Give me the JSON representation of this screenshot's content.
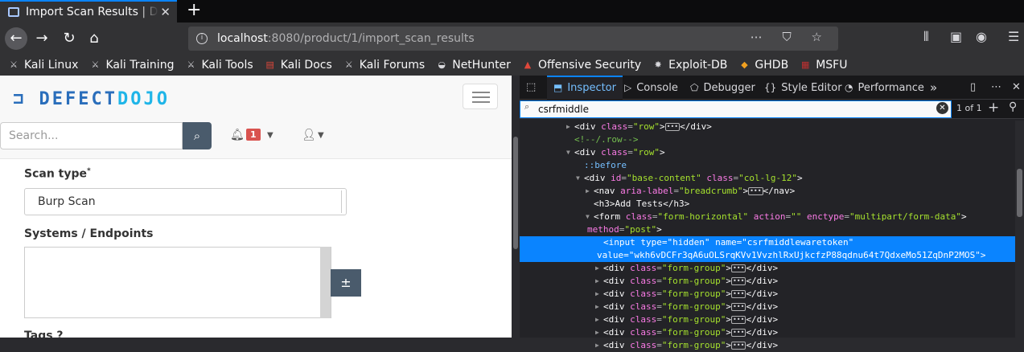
{
  "browser": {
    "tab_title": "Import Scan Results | DefectDojo",
    "tab_close": "✕",
    "new_tab": "+",
    "url_host": "localhost",
    "url_rest": ":8080/product/1/import_scan_results",
    "url_actions": "⋯ ⛉ ☆",
    "bookmarks": [
      {
        "label": "Kali Linux",
        "icon": "kali-dragon-icon"
      },
      {
        "label": "Kali Training",
        "icon": "kali-dragon-icon"
      },
      {
        "label": "Kali Tools",
        "icon": "kali-dragon-icon"
      },
      {
        "label": "Kali Docs",
        "icon": "kali-docs-icon"
      },
      {
        "label": "Kali Forums",
        "icon": "kali-dragon-icon"
      },
      {
        "label": "NetHunter",
        "icon": "nethunter-icon"
      },
      {
        "label": "Offensive Security",
        "icon": "offsec-icon"
      },
      {
        "label": "Exploit-DB",
        "icon": "exploitdb-icon"
      },
      {
        "label": "GHDB",
        "icon": "ghdb-icon"
      },
      {
        "label": "MSFU",
        "icon": "msfu-icon"
      }
    ]
  },
  "page": {
    "logo_left": "DEFECT",
    "logo_right": "DOJO",
    "search_placeholder": "Search...",
    "notification_count": "1",
    "scan_type_label": "Scan type",
    "scan_type_required": "*",
    "scan_type_value": "Burp Scan",
    "systems_label": "Systems / Endpoints",
    "plus_button": "±",
    "tags_label": "Tags"
  },
  "devtools": {
    "tabs": [
      "Inspector",
      "Console",
      "Debugger",
      "Style Editor",
      "Performance"
    ],
    "search_value": "csrfmiddle",
    "match_count": "1 of 1",
    "tree": [
      {
        "kind": "collapsed",
        "indent": 0,
        "tag": "div",
        "attrs": [
          [
            "class",
            "row"
          ]
        ]
      },
      {
        "kind": "comment",
        "indent": 0,
        "text": "<!--/.row-->"
      },
      {
        "kind": "open",
        "indent": 0,
        "tag": "div",
        "attrs": [
          [
            "class",
            "row"
          ]
        ]
      },
      {
        "kind": "pseudo",
        "indent": 1,
        "text": "::before"
      },
      {
        "kind": "open",
        "indent": 1,
        "tag": "div",
        "attrs": [
          [
            "id",
            "base-content"
          ],
          [
            "class",
            "col-lg-12"
          ]
        ]
      },
      {
        "kind": "collapsed",
        "indent": 2,
        "tag": "nav",
        "attrs": [
          [
            "aria-label",
            "breadcrumb"
          ]
        ]
      },
      {
        "kind": "text",
        "indent": 2,
        "text": "<h3>Add Tests</h3>"
      },
      {
        "kind": "open",
        "indent": 2,
        "tag": "form",
        "attrs": [
          [
            "class",
            "form-horizontal"
          ],
          [
            "action",
            ""
          ],
          [
            "enctype",
            "multipart/form-data"
          ]
        ]
      },
      {
        "kind": "cont",
        "indent": 2,
        "attrs": [
          [
            "method",
            "post"
          ]
        ]
      },
      {
        "kind": "selected",
        "indent": 3,
        "line1": "<input type=\"hidden\" name=\"csrfmiddlewaretoken\"",
        "line2": "value=\"wkh6vDCFr3qA6uOLSrqKVv1VvzhlRxUjkcfzP88qdnu64t7QdxeMo51ZqDnP2MOS\">"
      },
      {
        "kind": "collapsed",
        "indent": 3,
        "tag": "div",
        "attrs": [
          [
            "class",
            "form-group"
          ]
        ]
      },
      {
        "kind": "collapsed",
        "indent": 3,
        "tag": "div",
        "attrs": [
          [
            "class",
            "form-group"
          ]
        ]
      },
      {
        "kind": "collapsed",
        "indent": 3,
        "tag": "div",
        "attrs": [
          [
            "class",
            "form-group"
          ]
        ]
      },
      {
        "kind": "collapsed",
        "indent": 3,
        "tag": "div",
        "attrs": [
          [
            "class",
            "form-group"
          ]
        ]
      },
      {
        "kind": "collapsed",
        "indent": 3,
        "tag": "div",
        "attrs": [
          [
            "class",
            "form-group"
          ]
        ]
      },
      {
        "kind": "collapsed",
        "indent": 3,
        "tag": "div",
        "attrs": [
          [
            "class",
            "form-group"
          ]
        ]
      },
      {
        "kind": "collapsed",
        "indent": 3,
        "tag": "div",
        "attrs": [
          [
            "class",
            "form-group"
          ]
        ]
      }
    ]
  },
  "colors": {
    "devtools_bg": "#232327",
    "selection": "#0a84ff",
    "attr_name": "#fb7be6",
    "attr_value": "#a6e22e",
    "button_slate": "#4a5b6c",
    "badge_red": "#d9534f"
  }
}
